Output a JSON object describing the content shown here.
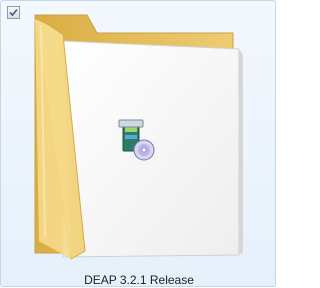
{
  "item": {
    "name": "DEAP 3.2.1 Release",
    "checked": true,
    "icon": "folder-icon",
    "overlay_icon": "installer-disc-icon"
  },
  "colors": {
    "selection_bg": "#e6f0fb",
    "selection_border": "#c2d8ef",
    "folder_front": "#f2d27a",
    "folder_back": "#e2b84c"
  }
}
